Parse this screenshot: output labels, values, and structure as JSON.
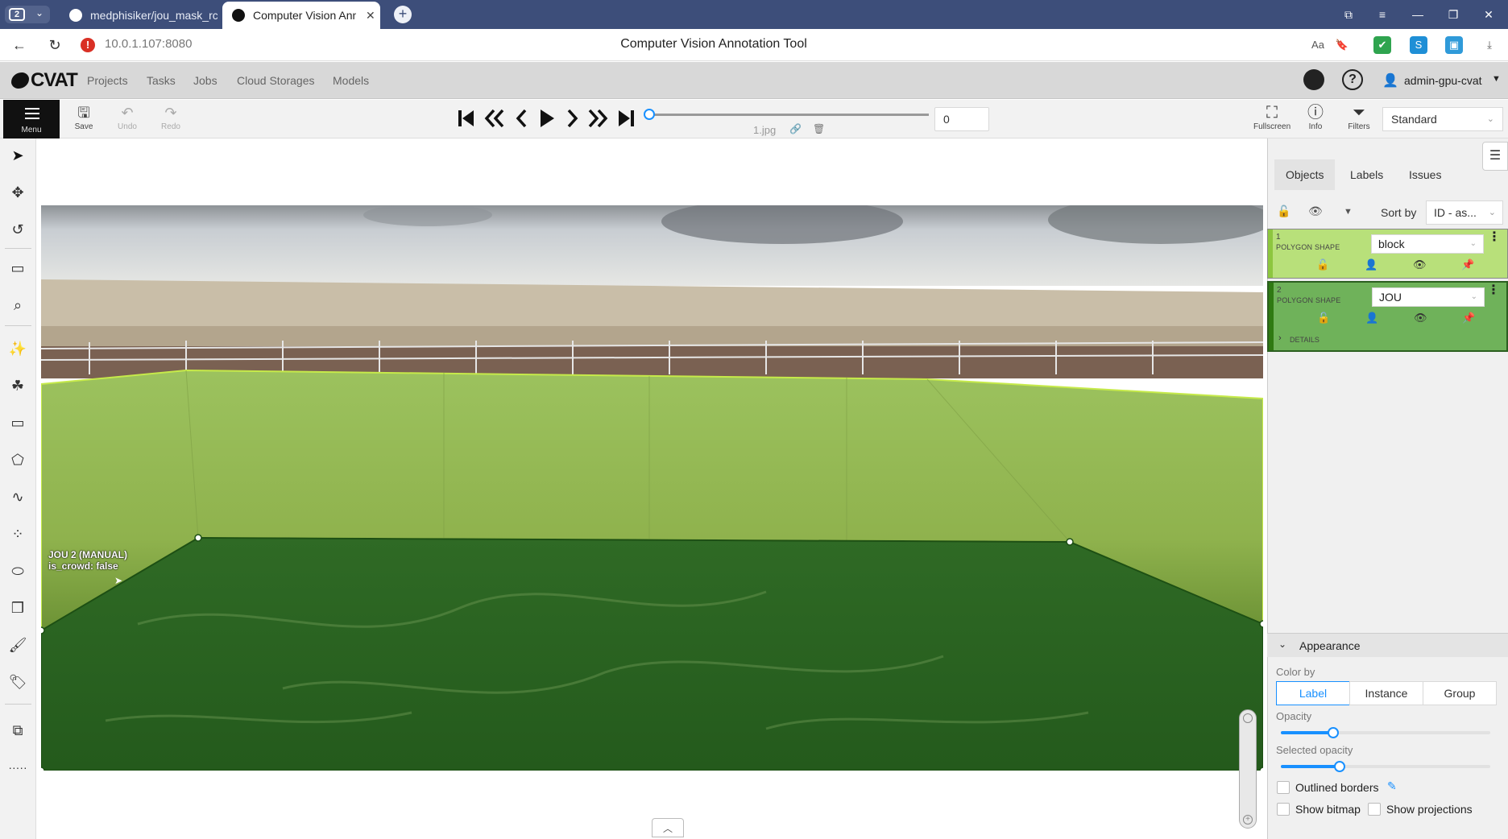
{
  "browser": {
    "tab_count": "2",
    "tabs": [
      {
        "label": "medphisiker/jou_mask_rcnn",
        "active": false
      },
      {
        "label": "Computer Vision Annotation Tool",
        "active": true
      }
    ],
    "url": "10.0.1.107:8080",
    "page_title": "Computer Vision Annotation Tool"
  },
  "header": {
    "logo": "CVAT",
    "nav": [
      "Projects",
      "Tasks",
      "Jobs",
      "Cloud Storages",
      "Models"
    ],
    "username": "admin-gpu-cvat"
  },
  "toolbar": {
    "menu_label": "Menu",
    "save_label": "Save",
    "undo_label": "Undo",
    "redo_label": "Redo",
    "filename": "1.jpg",
    "frame_number": "0",
    "fullscreen_label": "Fullscreen",
    "info_label": "Info",
    "filters_label": "Filters",
    "workspace": "Standard",
    "frame_progress": 0
  },
  "canvas": {
    "annotation_label_line1": "JOU 2 (MANUAL)",
    "annotation_label_line2": "is_crowd: false",
    "colors": {
      "block": "#a3d13a",
      "jou": "#2f7a12"
    }
  },
  "sidebar": {
    "tabs": [
      "Objects",
      "Labels",
      "Issues"
    ],
    "sort_by_label": "Sort by",
    "sort_by_value": "ID - as...",
    "objects": [
      {
        "id": "1",
        "type": "POLYGON SHAPE",
        "label": "block",
        "color": "#b8e07a"
      },
      {
        "id": "2",
        "type": "POLYGON SHAPE",
        "label": "JOU",
        "color": "#6fb25a",
        "details": "DETAILS"
      }
    ],
    "appearance": {
      "title": "Appearance",
      "color_by_label": "Color by",
      "color_by_options": [
        "Label",
        "Instance",
        "Group"
      ],
      "color_by_selected": "Label",
      "opacity_label": "Opacity",
      "opacity_value": 0.25,
      "selected_opacity_label": "Selected opacity",
      "selected_opacity_value": 0.28,
      "outlined_borders_label": "Outlined borders",
      "show_bitmap_label": "Show bitmap",
      "show_projections_label": "Show projections"
    }
  }
}
